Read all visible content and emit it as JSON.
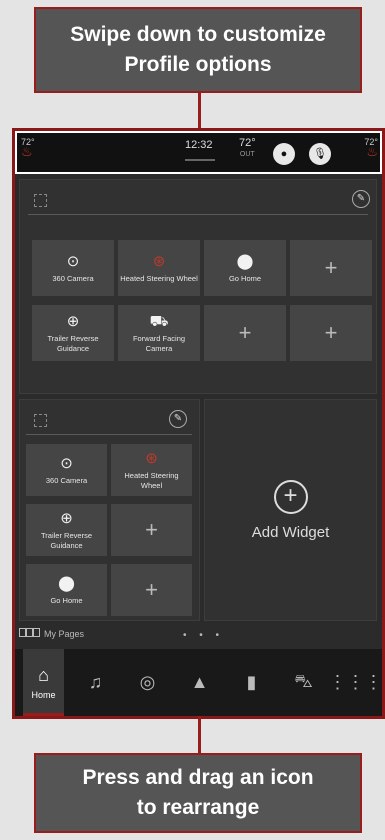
{
  "callouts": {
    "top": "Swipe down to customize\nProfile options",
    "bottom": "Press and drag an icon\nto rearrange"
  },
  "statusbar": {
    "left_temp": "72°",
    "right_temp": "72°",
    "time": "12:32",
    "outside_temp": "72°",
    "outside_label": "OUT",
    "profile_icon": "person-icon",
    "voice_icon": "microphone-icon"
  },
  "top_widget": {
    "tiles": [
      {
        "label": "360 Camera",
        "icon": "camera-360-icon"
      },
      {
        "label": "Heated Steering Wheel",
        "icon": "heated-steering-wheel-icon"
      },
      {
        "label": "Go Home",
        "icon": "location-pin-icon"
      },
      {
        "label": "+",
        "icon": "plus-icon"
      },
      {
        "label": "Trailer Reverse Guidance",
        "icon": "trailer-icon"
      },
      {
        "label": "Forward Facing Camera",
        "icon": "forward-camera-icon"
      },
      {
        "label": "+",
        "icon": "plus-icon"
      },
      {
        "label": "+",
        "icon": "plus-icon"
      }
    ]
  },
  "left_widget": {
    "tiles": [
      {
        "label": "360 Camera",
        "icon": "camera-360-icon"
      },
      {
        "label": "Heated Steering Wheel",
        "icon": "heated-steering-wheel-icon"
      },
      {
        "label": "Trailer Reverse Guidance",
        "icon": "trailer-icon"
      },
      {
        "label": "+",
        "icon": "plus-icon"
      },
      {
        "label": "Go Home",
        "icon": "location-pin-icon"
      },
      {
        "label": "+",
        "icon": "plus-icon"
      }
    ]
  },
  "add_widget": {
    "label": "Add Widget",
    "icon": "+"
  },
  "mypages": {
    "label": "My Pages",
    "dots": "• • •"
  },
  "navbar": {
    "home_label": "Home",
    "items": [
      "home-icon",
      "music-icon",
      "comfort-icon",
      "navigation-icon",
      "phone-icon",
      "vehicle-icon",
      "apps-grid-icon"
    ]
  },
  "colors": {
    "accent": "#9a1d1d",
    "callout_bg": "#555555",
    "screen_bg": "#2b2b2b"
  }
}
